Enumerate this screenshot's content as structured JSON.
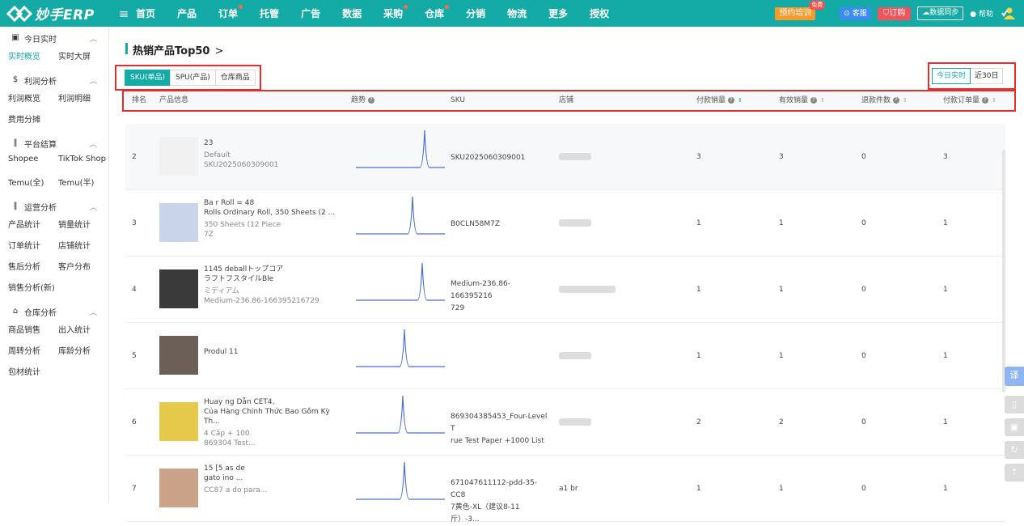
{
  "brand": {
    "logo_text": "妙手ERP"
  },
  "nav": {
    "items": [
      {
        "label": "首页",
        "dot": false
      },
      {
        "label": "产品",
        "dot": false
      },
      {
        "label": "订单",
        "dot": true
      },
      {
        "label": "托管",
        "dot": false
      },
      {
        "label": "广告",
        "dot": false
      },
      {
        "label": "数据",
        "dot": false
      },
      {
        "label": "采购",
        "dot": true
      },
      {
        "label": "仓库",
        "dot": true
      },
      {
        "label": "分销",
        "dot": false
      },
      {
        "label": "物流",
        "dot": false
      },
      {
        "label": "更多",
        "dot": false
      },
      {
        "label": "授权",
        "dot": false
      }
    ],
    "train_label": "预约培训",
    "free_badge": "免费",
    "service_label": "客服",
    "order_label": "订购",
    "sync_label": "数据同步",
    "help_label": "帮助"
  },
  "sidebar": {
    "sections": [
      {
        "label": "今日实时",
        "icon": "car-icon",
        "items": [
          "实时概览",
          "实时大屏"
        ],
        "active": "实时概览"
      },
      {
        "label": "利润分析",
        "icon": "dollar-icon",
        "items": [
          "利润概览",
          "利润明细",
          "费用分摊"
        ]
      },
      {
        "label": "平台结算",
        "icon": "bar-chart-icon",
        "items": [
          "Shopee",
          "TikTok Shop",
          "Temu(全)",
          "Temu(半)"
        ]
      },
      {
        "label": "运营分析",
        "icon": "bar-chart-icon",
        "items": [
          "产品统计",
          "销量统计",
          "订单统计",
          "店铺统计",
          "售后分析",
          "客户分布",
          "销售分析(新)"
        ]
      },
      {
        "label": "仓库分析",
        "icon": "warehouse-icon",
        "items": [
          "商品销售",
          "出入统计",
          "周转分析",
          "库龄分析",
          "包材统计"
        ]
      }
    ]
  },
  "main": {
    "title": "热销产品Top50",
    "chevron": ">",
    "tabs": [
      "SKU(单品)",
      "SPU(产品)",
      "仓库商品"
    ],
    "range_tabs": [
      "今日实时",
      "近30日"
    ],
    "columns": {
      "rank": "排名",
      "product": "产品信息",
      "trend": "趋势",
      "sku": "SKU",
      "shop": "店铺",
      "paid_sales": "付款销量",
      "valid_sales": "有效销量",
      "refunds": "退款件数",
      "paid_orders": "付款订单量"
    },
    "rows": [
      {
        "rank": "2",
        "name1": "23",
        "name2": "",
        "meta1": "Default",
        "meta2": "SKU2025060309001",
        "sku": "SKU2025060309001",
        "sku2": "",
        "shop": "",
        "paid_sales": "3",
        "valid_sales": "3",
        "refunds": "0",
        "paid_orders": "3",
        "peak": 0.55
      },
      {
        "rank": "3",
        "name1": "Ba r Roll = 48",
        "name2": "Rolls Ordinary Roll, 350 Sheets (2 ...",
        "meta1": "350 Sheets (12 Piece",
        "meta2": "7Z",
        "sku": "B0CLN58M7Z",
        "sku2": "",
        "shop": "",
        "paid_sales": "1",
        "valid_sales": "1",
        "refunds": "0",
        "paid_orders": "1",
        "peak": 0.55
      },
      {
        "rank": "4",
        "name1": "1145 deballトップコア",
        "name2": "ラフトフスタイルBle",
        "meta1": "ミディアム",
        "meta2": "Medium-236.86-166395216729",
        "sku": "Medium-236.86-166395216",
        "sku2": "729",
        "shop": "",
        "paid_sales": "1",
        "valid_sales": "1",
        "refunds": "0",
        "paid_orders": "1",
        "peak": 0.55
      },
      {
        "rank": "5",
        "name1": "Produl 11",
        "name2": "",
        "meta1": "",
        "meta2": "",
        "sku": "",
        "sku2": "",
        "shop": "",
        "paid_sales": "1",
        "valid_sales": "1",
        "refunds": "0",
        "paid_orders": "1",
        "peak": 0.55
      },
      {
        "rank": "6",
        "name1": "Huay ng Dẫn CET4,",
        "name2": "Của Hàng Chính Thức Bao Gồm Kỳ Th...",
        "meta1": "4 Cấp + 100",
        "meta2": "869304 Test...",
        "sku": "869304385453_Four-Level T",
        "sku2": "rue Test Paper +1000 List",
        "shop": "",
        "paid_sales": "2",
        "valid_sales": "2",
        "refunds": "0",
        "paid_orders": "1",
        "peak": 0.55
      },
      {
        "rank": "7",
        "name1": "15 [5 as de",
        "name2": "gato ino ...",
        "meta1": "CC87 a do para...",
        "meta2": "",
        "sku": "671047611112-pdd-35-CC8",
        "sku2": "7黄色-XL（建议8-11斤）-3...",
        "shop": "a1 br",
        "paid_sales": "1",
        "valid_sales": "1",
        "refunds": "0",
        "paid_orders": "1",
        "peak": 0.55
      }
    ]
  },
  "float_tools": [
    "translate-icon",
    "phone-icon",
    "screenshot-icon",
    "refresh-icon",
    "upload-icon"
  ],
  "colors": {
    "primary": "#14aaa5",
    "highlight": "#e52b2b",
    "spark": "#4a6fd1"
  }
}
